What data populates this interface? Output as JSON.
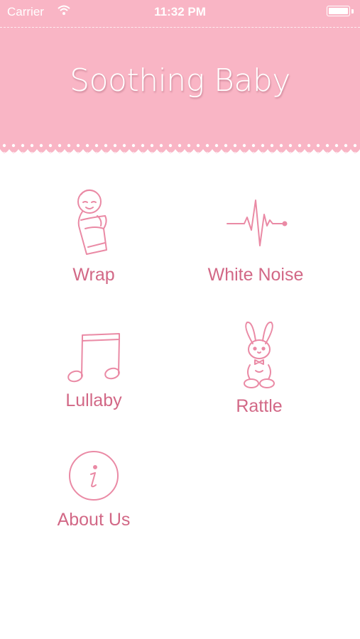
{
  "status_bar": {
    "carrier": "Carrier",
    "time": "11:32 PM",
    "wifi_icon": "wifi-icon",
    "battery_icon": "battery-icon"
  },
  "header": {
    "title": "Soothing Baby",
    "background": "#f9b5c5"
  },
  "menu": {
    "items": [
      {
        "label": "Wrap",
        "icon": "swaddled-baby-icon"
      },
      {
        "label": "White Noise",
        "icon": "heartbeat-wave-icon"
      },
      {
        "label": "Lullaby",
        "icon": "music-note-icon"
      },
      {
        "label": "Rattle",
        "icon": "bunny-rattle-icon"
      },
      {
        "label": "About Us",
        "icon": "info-icon"
      }
    ],
    "accent": "#d26886"
  }
}
